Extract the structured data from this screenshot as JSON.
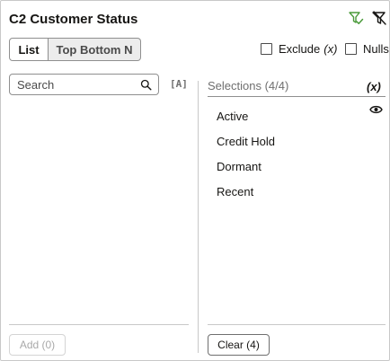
{
  "header": {
    "title": "C2 Customer Status",
    "icons": [
      "filter-apply-icon",
      "clear-filter-icon"
    ]
  },
  "mode_tabs": [
    {
      "label": "List",
      "active": true
    },
    {
      "label": "Top Bottom N",
      "active": false
    }
  ],
  "options": {
    "exclude_label": "Exclude",
    "exclude_suffix": "(x)",
    "exclude_checked": false,
    "nulls_label": "Nulls",
    "nulls_checked": false
  },
  "search": {
    "placeholder": "Search",
    "value": "",
    "case_toggle_icon": "[A]"
  },
  "selections": {
    "header": "Selections (4/4)",
    "expression_label": "(x)",
    "items": [
      "Active",
      "Credit Hold",
      "Dormant",
      "Recent"
    ]
  },
  "buttons": {
    "add_label": "Add (0)",
    "add_enabled": false,
    "clear_label": "Clear (4)"
  },
  "colors": {
    "apply_icon_accent": "#4a9a3a",
    "border": "#c8c8c8",
    "muted_text": "#6f6f6f",
    "inactive_tab_bg": "#ececec"
  }
}
